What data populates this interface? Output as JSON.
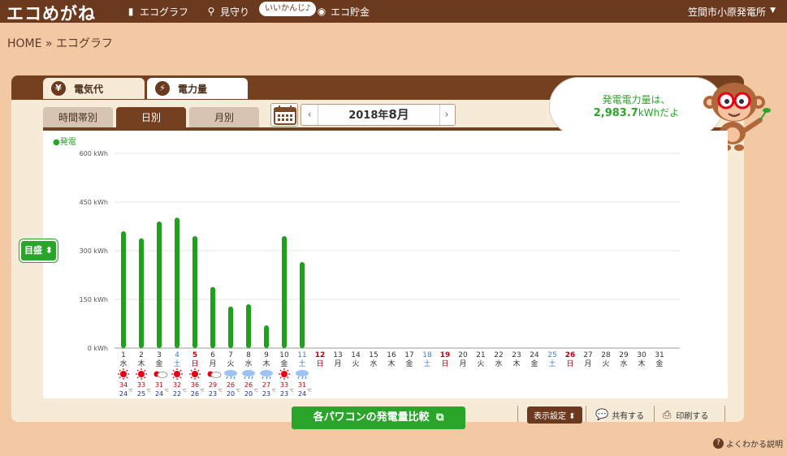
{
  "header": {
    "logo": "エコめがね",
    "nav": [
      {
        "label": "エコグラフ",
        "icon": "bar-chart-icon"
      },
      {
        "label": "見守り",
        "icon": "magnifier-icon"
      },
      {
        "label": "エコ貯金",
        "icon": "coin-icon"
      }
    ],
    "bubble": "いいかんじ♪",
    "plant_name": "笠間市小原発電所",
    "plant_caret": "▼"
  },
  "breadcrumb": "HOME » エコグラフ",
  "top_tabs": [
    {
      "label": "電気代",
      "icon_glyph": "¥",
      "icon": "yen-icon"
    },
    {
      "label": "電力量",
      "icon_glyph": "⚡",
      "icon": "lightning-icon"
    }
  ],
  "sub_tabs": [
    "時間帯別",
    "日別",
    "月別"
  ],
  "date_nav": {
    "prev": "‹",
    "next": "›",
    "year": "2018年",
    "month": "8月"
  },
  "speech": {
    "line1": "発電電力量は、",
    "value": "2,983.7",
    "unit": "kWhだよ"
  },
  "meter_button": "目盛 ⬍",
  "compare_button": "各パワコンの発電量比較",
  "tools": {
    "display_settings": "表示設定 ⬍",
    "share": "共有する",
    "print": "印刷する"
  },
  "help": "よくわかる説明",
  "colors": {
    "brand_brown": "#6b3a1e",
    "green": "#2aa52a",
    "sun_red": "#e60012",
    "rain_blue": "#3a7fd0"
  },
  "chart_data": {
    "type": "bar",
    "legend": "●発電",
    "y_unit": "kWh",
    "ylim": [
      0,
      600
    ],
    "yticks": [
      "0 kWh",
      "150 kWh",
      "300 kWh",
      "450 kWh",
      "600 kWh"
    ],
    "ytick_values": [
      0,
      150,
      300,
      450,
      600
    ],
    "categories": [
      "1",
      "2",
      "3",
      "4",
      "5",
      "6",
      "7",
      "8",
      "9",
      "10",
      "11",
      "12",
      "13",
      "14",
      "15",
      "16",
      "17",
      "18",
      "19",
      "20",
      "21",
      "22",
      "23",
      "24",
      "25",
      "26",
      "27",
      "28",
      "29",
      "30",
      "31"
    ],
    "weekdays": [
      "水",
      "木",
      "金",
      "土",
      "日",
      "月",
      "火",
      "水",
      "木",
      "金",
      "土",
      "日",
      "月",
      "火",
      "水",
      "木",
      "金",
      "土",
      "日",
      "月",
      "火",
      "水",
      "木",
      "金",
      "土",
      "日",
      "月",
      "火",
      "水",
      "木",
      "金"
    ],
    "values": [
      360,
      338,
      390,
      402,
      345,
      188,
      128,
      135,
      70,
      345,
      265,
      null,
      null,
      null,
      null,
      null,
      null,
      null,
      null,
      null,
      null,
      null,
      null,
      null,
      null,
      null,
      null,
      null,
      null,
      null,
      null
    ],
    "weather": [
      "sun",
      "sun",
      "sun-cloud",
      "sun",
      "sun",
      "sun-cloud",
      "cloud-rain",
      "cloud-rain",
      "cloud-rain",
      "sun",
      "cloud-rain"
    ],
    "temp_high": [
      "34",
      "33",
      "31",
      "32",
      "36",
      "29",
      "26",
      "26",
      "27",
      "33",
      "31"
    ],
    "temp_low": [
      "24",
      "25",
      "24",
      "22",
      "26",
      "23",
      "20",
      "20",
      "23",
      "23",
      "24"
    ],
    "temp_unit": "℃"
  }
}
